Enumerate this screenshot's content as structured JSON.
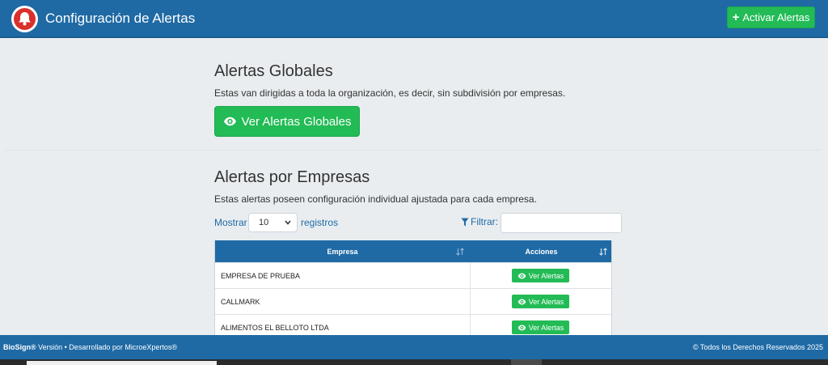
{
  "header": {
    "title": "Configuración de Alertas",
    "activate_label": "Activar Alertas",
    "logo_icon": "bell-icon",
    "color": "#1f6aa5"
  },
  "global": {
    "title": "Alertas Globales",
    "description": "Estas van dirigidas a toda la organización, es decir, sin subdivisión por empresas.",
    "button_label": "Ver Alertas Globales",
    "button_color": "#22bb55"
  },
  "companies": {
    "title": "Alertas por Empresas",
    "description": "Estas alertas poseen configuración individual ajustada para cada empresa.",
    "show_label": "Mostrar",
    "page_size": "10",
    "records_label": "registros",
    "filter_label": "Filtrar:",
    "filter_value": "",
    "columns": [
      "Empresa",
      "Acciones"
    ],
    "rows": [
      {
        "name": "EMPRESA DE PRUEBA",
        "action": "Ver Alertas"
      },
      {
        "name": "CALLMARK",
        "action": "Ver Alertas"
      },
      {
        "name": "ALIMENTOS EL BELLOTO LTDA",
        "action": "Ver Alertas"
      }
    ]
  },
  "footer": {
    "brand": "BioSign®",
    "left_rest": " Versión • Desarrollado por MicroeXpertos®",
    "right": "© Todos los Derechos Reservados 2025"
  }
}
